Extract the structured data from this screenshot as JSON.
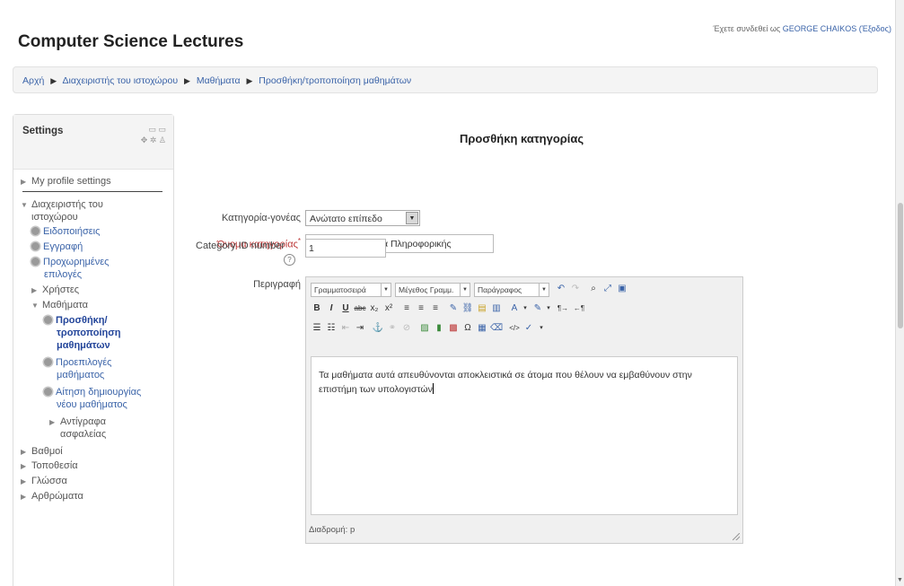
{
  "site": {
    "title": "Computer Science Lectures"
  },
  "login": {
    "prefix": "Έχετε συνδεθεί ως",
    "user": "GEORGE CHAIKOS",
    "logout": "(Έξοδος)"
  },
  "breadcrumb": [
    "Αρχή",
    "Διαχειριστής του ιστοχώρου",
    "Μαθήματα",
    "Προσθήκη/τροποποίηση μαθημάτων"
  ],
  "settings": {
    "title": "Settings",
    "items": {
      "my_profile": "My profile settings",
      "site_admin": "Διαχειριστής του",
      "site_admin_2": "ιστοχώρου",
      "notifications": "Ειδοποιήσεις",
      "registration": "Εγγραφή",
      "advanced": "Προχωρημένες",
      "advanced_2": "επιλογές",
      "users": "Χρήστες",
      "courses": "Μαθήματα",
      "add_edit": "Προσθήκη/",
      "add_edit_2": "τροποποίηση",
      "add_edit_3": "μαθημάτων",
      "defaults": "Προεπιλογές",
      "defaults_2": "μαθήματος",
      "request": "Αίτηση δημιουργίας",
      "request_2": "νέου μαθήματος",
      "backups": "Αντίγραφα",
      "backups_2": "ασφαλείας",
      "grades": "Βαθμοί",
      "location": "Τοποθεσία",
      "language": "Γλώσσα",
      "plugins": "Αρθρώματα"
    }
  },
  "form": {
    "title": "Προσθήκη κατηγορίας",
    "parent_label": "Κατηγορία-γονέας",
    "parent_value": "Ανώτατο επίπεδο",
    "name_label": "Όνομα κατηγορίας",
    "name_required": "*",
    "name_value": "Μαθήματα Πυρήνα Πληροφορικής",
    "idnumber_label": "Category ID number",
    "idnumber_value": "1",
    "help_glyph": "?",
    "desc_label": "Περιγραφή"
  },
  "editor": {
    "format_select": "Γραμματοσειρά",
    "size_select": "Μέγεθος Γραμμ.",
    "paragraph_select": "Παράγραφος",
    "content": "Τα μαθήματα αυτά απευθύνονται αποκλειστικά σε άτομα που θέλουν να εμβαθύνουν στην επιστήμη των υπολογιστών",
    "path": "Διαδρομή: p"
  }
}
